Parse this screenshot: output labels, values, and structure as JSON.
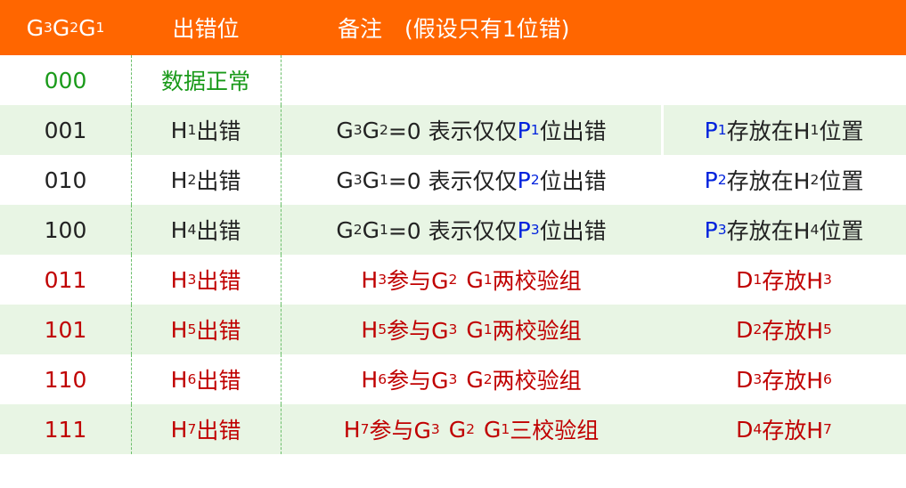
{
  "header": {
    "col1": {
      "a": "G",
      "s1": "3",
      "b": "G",
      "s2": "2",
      "c": "G",
      "s3": "1"
    },
    "col2": "出错位",
    "col3": "备注　(假设只有1位错)"
  },
  "rows": [
    {
      "code": "000",
      "pos": "数据正常"
    },
    {
      "code": "001",
      "pos_h": "H",
      "pos_s": "1",
      "pos_t": "出错",
      "note_pre": "G",
      "note_s1": "3",
      "note_mid": "G",
      "note_s2": "2",
      "note_eq": "=0 表示仅仅",
      "note_p": "P",
      "note_ps": "1",
      "note_end": "位出错",
      "r_p": "P",
      "r_ps": "1",
      "r_mid": "存放在H",
      "r_hs": "1",
      "r_end": "位置"
    },
    {
      "code": "010",
      "pos_h": "H",
      "pos_s": "2",
      "pos_t": "出错",
      "note_pre": "G",
      "note_s1": "3",
      "note_mid": "G",
      "note_s2": "1",
      "note_eq": "=0 表示仅仅",
      "note_p": "P",
      "note_ps": "2",
      "note_end": "位出错",
      "r_p": "P",
      "r_ps": "2",
      "r_mid": "存放在H",
      "r_hs": "2",
      "r_end": "位置"
    },
    {
      "code": "100",
      "pos_h": "H",
      "pos_s": "4",
      "pos_t": "出错",
      "note_pre": "G",
      "note_s1": "2",
      "note_mid": "G",
      "note_s2": "1",
      "note_eq": "=0 表示仅仅",
      "note_p": "P",
      "note_ps": "3",
      "note_end": "位出错",
      "r_p": "P",
      "r_ps": "3",
      "r_mid": "存放在H",
      "r_hs": "4",
      "r_end": "位置"
    },
    {
      "code": "011",
      "pos_h": "H",
      "pos_s": "3",
      "pos_t": "出错",
      "n_h": "H",
      "n_hs": "3",
      "n_t1": "参与G",
      "n_g1": "2",
      "n_t2": "G",
      "n_g2": "1",
      "n_end": "两校验组",
      "d": "D",
      "ds": "1",
      "d_mid": "存放H",
      "d_hs": "3"
    },
    {
      "code": "101",
      "pos_h": "H",
      "pos_s": "5",
      "pos_t": "出错",
      "n_h": "H",
      "n_hs": "5",
      "n_t1": "参与G",
      "n_g1": "3",
      "n_t2": "G",
      "n_g2": "1",
      "n_end": "两校验组",
      "d": "D",
      "ds": "2",
      "d_mid": "存放H",
      "d_hs": "5"
    },
    {
      "code": "110",
      "pos_h": "H",
      "pos_s": "6",
      "pos_t": "出错",
      "n_h": "H",
      "n_hs": "6",
      "n_t1": "参与G",
      "n_g1": "3",
      "n_t2": "G",
      "n_g2": "2",
      "n_end": "两校验组",
      "d": "D",
      "ds": "3",
      "d_mid": "存放H",
      "d_hs": "6"
    },
    {
      "code": "111",
      "pos_h": "H",
      "pos_s": "7",
      "pos_t": "出错",
      "n_h": "H",
      "n_hs": "7",
      "n_t1": "参与G",
      "n_g1": "3",
      "n_t2": "G",
      "n_g2": "2",
      "n_t3": "G",
      "n_g3": "1",
      "n_end": "三校验组",
      "d": "D",
      "ds": "4",
      "d_mid": "存放H",
      "d_hs": "7"
    }
  ]
}
